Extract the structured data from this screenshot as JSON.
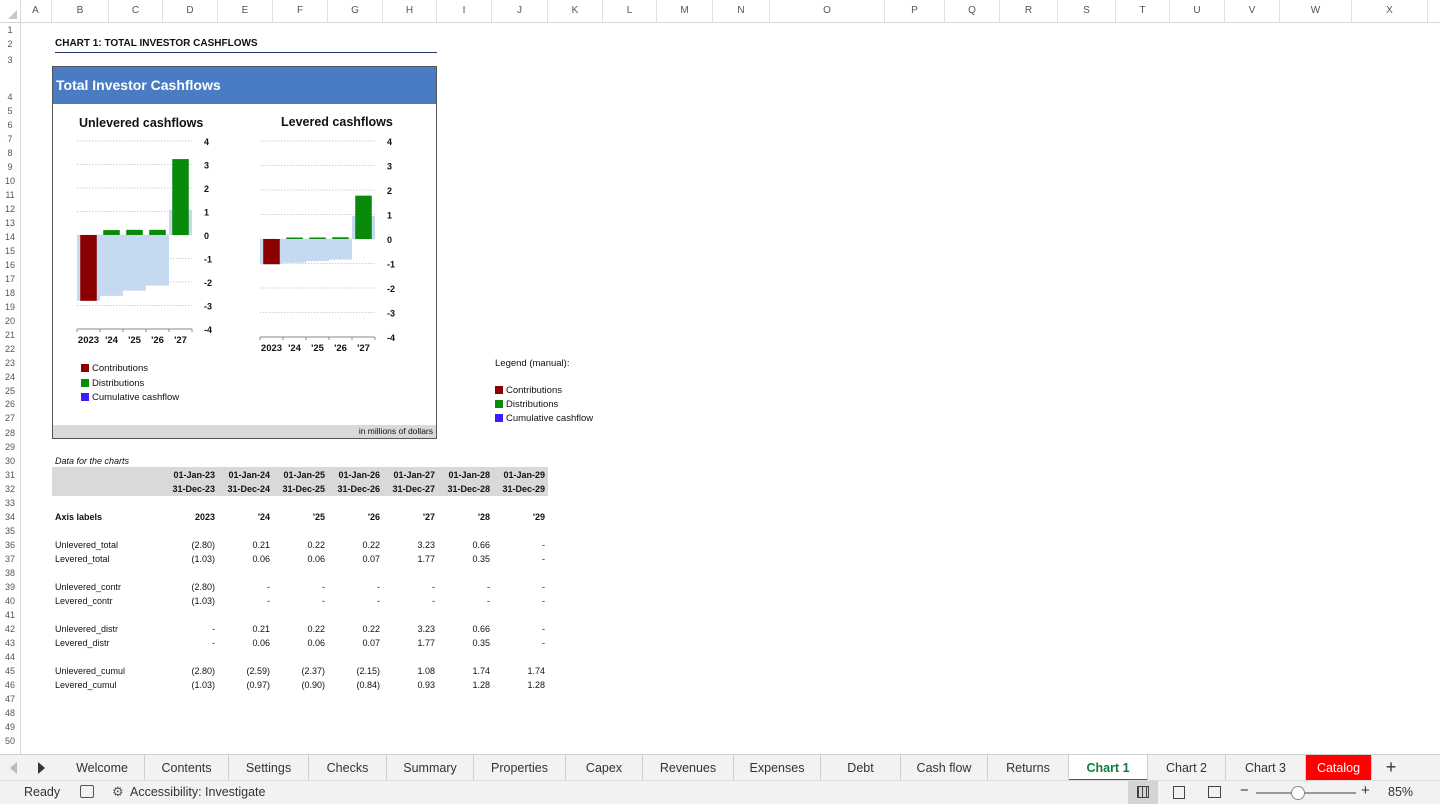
{
  "columns": [
    "A",
    "B",
    "C",
    "D",
    "E",
    "F",
    "G",
    "H",
    "I",
    "J",
    "K",
    "L",
    "M",
    "N",
    "O",
    "P",
    "Q",
    "R",
    "S",
    "T",
    "U",
    "V",
    "W",
    "X"
  ],
  "rows": [
    "1",
    "2",
    "3",
    "4",
    "5",
    "6",
    "7",
    "8",
    "9",
    "10",
    "11",
    "12",
    "13",
    "14",
    "15",
    "16",
    "17",
    "18",
    "19",
    "20",
    "21",
    "22",
    "23",
    "24",
    "25",
    "26",
    "27",
    "28",
    "29",
    "30",
    "31",
    "32",
    "33",
    "34",
    "35",
    "36",
    "37",
    "38",
    "39",
    "40",
    "41",
    "42",
    "43",
    "44",
    "45",
    "46",
    "47",
    "48",
    "49",
    "50"
  ],
  "sheet": {
    "heading": "CHART 1: TOTAL INVESTOR CASHFLOWS",
    "chart_banner": "Total Investor Cashflows",
    "chart_footer": "in millions of dollars",
    "manual_legend_title": "Legend (manual):",
    "legend": [
      "Contributions",
      "Distributions",
      "Cumulative cashflow"
    ],
    "legend_colors": [
      "#8b0000",
      "#0a8a0a",
      "#3a1cff"
    ]
  },
  "chart_data": [
    {
      "type": "bar",
      "title": "Unlevered cashflows",
      "categories": [
        "2023",
        "'24",
        "'25",
        "'26",
        "'27"
      ],
      "series": [
        {
          "name": "Contributions",
          "color": "#8b0000",
          "values": [
            -2.8,
            0,
            0,
            0,
            0
          ]
        },
        {
          "name": "Distributions",
          "color": "#0a8a0a",
          "values": [
            0,
            0.21,
            0.22,
            0.22,
            3.23
          ]
        },
        {
          "name": "Cumulative cashflow",
          "color": "#c5d9f1",
          "values": [
            -2.8,
            -2.59,
            -2.37,
            -2.15,
            1.08
          ]
        }
      ],
      "yticks": [
        "4",
        "3",
        "2",
        "1",
        "0",
        "-1",
        "-2",
        "-3",
        "-4"
      ],
      "ylim": [
        -4,
        4
      ],
      "grid": true
    },
    {
      "type": "bar",
      "title": "Levered cashflows",
      "categories": [
        "2023",
        "'24",
        "'25",
        "'26",
        "'27"
      ],
      "series": [
        {
          "name": "Contributions",
          "color": "#8b0000",
          "values": [
            -1.03,
            0,
            0,
            0,
            0
          ]
        },
        {
          "name": "Distributions",
          "color": "#0a8a0a",
          "values": [
            0,
            0.06,
            0.06,
            0.07,
            1.77
          ]
        },
        {
          "name": "Cumulative cashflow",
          "color": "#c5d9f1",
          "values": [
            -1.03,
            -0.97,
            -0.9,
            -0.84,
            0.93
          ]
        }
      ],
      "yticks": [
        "4",
        "3",
        "2",
        "1",
        "0",
        "-1",
        "-2",
        "-3",
        "-4"
      ],
      "ylim": [
        -4,
        4
      ],
      "grid": true
    }
  ],
  "table": {
    "caption": "Data for the charts",
    "start_dates": [
      "01-Jan-23",
      "01-Jan-24",
      "01-Jan-25",
      "01-Jan-26",
      "01-Jan-27",
      "01-Jan-28",
      "01-Jan-29"
    ],
    "end_dates": [
      "31-Dec-23",
      "31-Dec-24",
      "31-Dec-25",
      "31-Dec-26",
      "31-Dec-27",
      "31-Dec-28",
      "31-Dec-29"
    ],
    "axis_label_title": "Axis labels",
    "axis_labels": [
      "2023",
      "'24",
      "'25",
      "'26",
      "'27",
      "'28",
      "'29"
    ],
    "rows": [
      {
        "label": "Unlevered_total",
        "values": [
          "(2.80)",
          "0.21",
          "0.22",
          "0.22",
          "3.23",
          "0.66",
          "-"
        ]
      },
      {
        "label": "Levered_total",
        "values": [
          "(1.03)",
          "0.06",
          "0.06",
          "0.07",
          "1.77",
          "0.35",
          "-"
        ]
      },
      {
        "label": "Unlevered_contr",
        "values": [
          "(2.80)",
          "-",
          "-",
          "-",
          "-",
          "-",
          "-"
        ]
      },
      {
        "label": "Levered_contr",
        "values": [
          "(1.03)",
          "-",
          "-",
          "-",
          "-",
          "-",
          "-"
        ]
      },
      {
        "label": "Unlevered_distr",
        "values": [
          "-",
          "0.21",
          "0.22",
          "0.22",
          "3.23",
          "0.66",
          "-"
        ]
      },
      {
        "label": "Levered_distr",
        "values": [
          "-",
          "0.06",
          "0.06",
          "0.07",
          "1.77",
          "0.35",
          "-"
        ]
      },
      {
        "label": "Unlevered_cumul",
        "values": [
          "(2.80)",
          "(2.59)",
          "(2.37)",
          "(2.15)",
          "1.08",
          "1.74",
          "1.74"
        ]
      },
      {
        "label": "Levered_cumul",
        "values": [
          "(1.03)",
          "(0.97)",
          "(0.90)",
          "(0.84)",
          "0.93",
          "1.28",
          "1.28"
        ]
      }
    ]
  },
  "tabs": [
    "Welcome",
    "Contents",
    "Settings",
    "Checks",
    "Summary",
    "Properties",
    "Capex",
    "Revenues",
    "Expenses",
    "Debt",
    "Cash flow",
    "Returns",
    "Chart 1",
    "Chart 2",
    "Chart 3",
    "Catalog"
  ],
  "active_tab": "Chart 1",
  "status": {
    "ready": "Ready",
    "accessibility": "Accessibility: Investigate",
    "zoom": "85%",
    "zoom_level": 0.85
  }
}
